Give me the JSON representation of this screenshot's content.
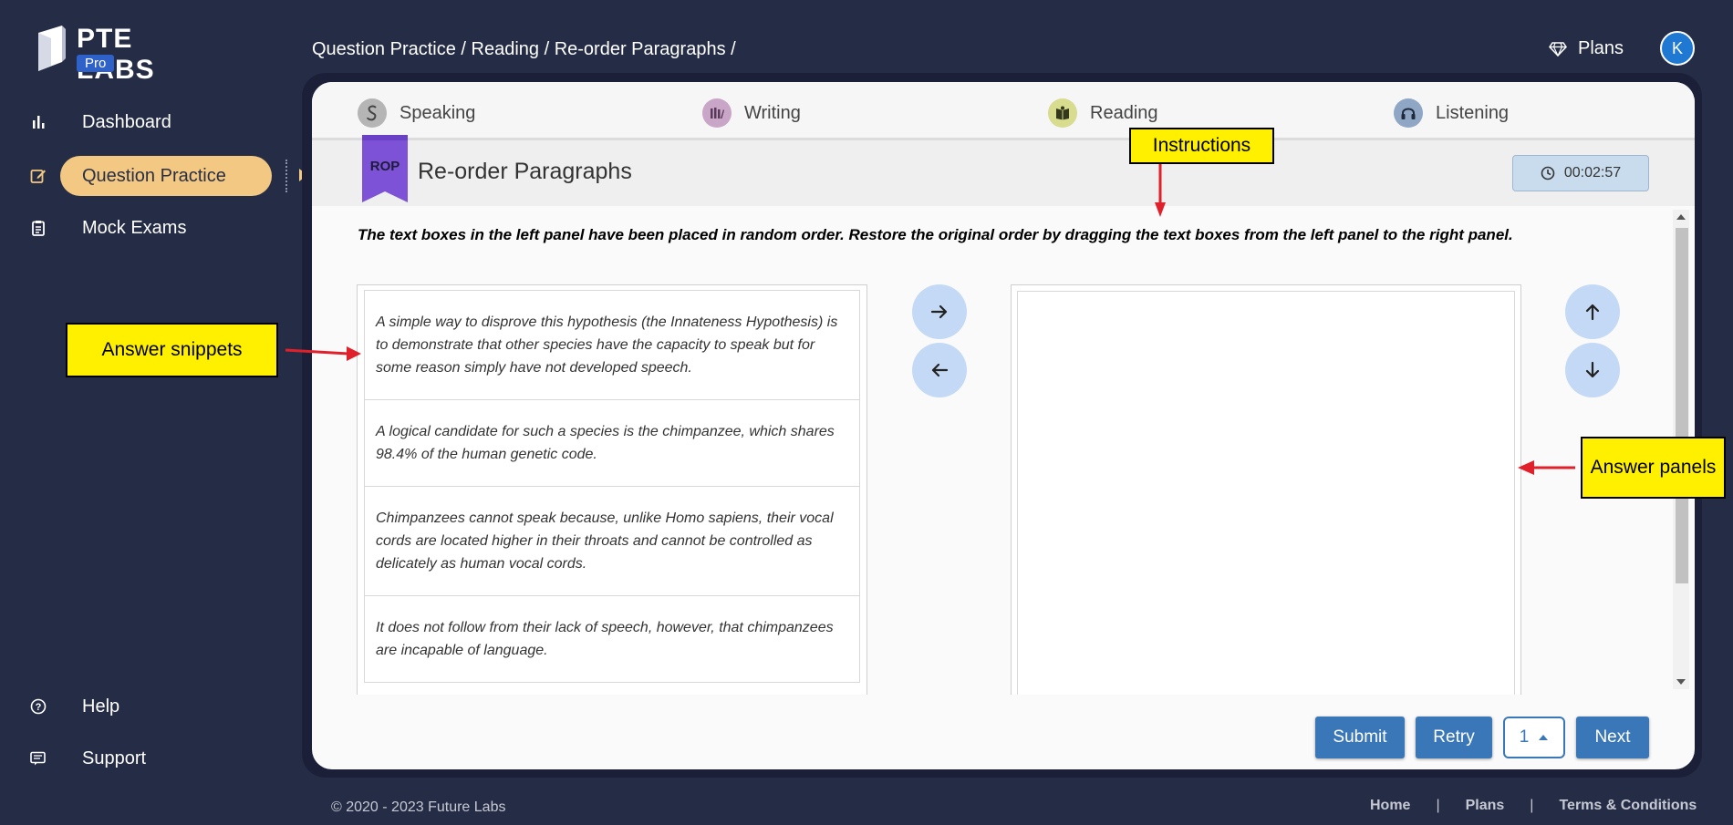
{
  "brand": {
    "name": "PTE LABS",
    "badge": "Pro"
  },
  "sidebar": {
    "items": [
      {
        "label": "Dashboard",
        "icon": "bar-chart-icon"
      },
      {
        "label": "Question Practice",
        "icon": "edit-icon"
      },
      {
        "label": "Mock Exams",
        "icon": "clipboard-icon"
      }
    ],
    "bottom_items": [
      {
        "label": "Help",
        "icon": "help-icon"
      },
      {
        "label": "Support",
        "icon": "support-icon"
      }
    ]
  },
  "header": {
    "breadcrumb": "Question Practice / Reading / Re-order Paragraphs /",
    "plans_label": "Plans",
    "avatar_initial": "K"
  },
  "tabs": [
    {
      "label": "Speaking",
      "color": "#b5b5b5",
      "icon": "S"
    },
    {
      "label": "Writing",
      "color": "#c9a5c8",
      "icon": "W"
    },
    {
      "label": "Reading",
      "color": "#d7dc8f",
      "icon": "R"
    },
    {
      "label": "Listening",
      "color": "#8fa6c5",
      "icon": "L"
    }
  ],
  "question": {
    "badge": "ROP",
    "title": "Re-order Paragraphs",
    "timer": "00:02:57",
    "instructions": "The text boxes in the left panel have been placed in random order. Restore the original order by dragging the text boxes from the left panel to the right panel.",
    "snippets": [
      "A simple way to disprove this hypothesis (the Innateness Hypothesis) is to demonstrate that other species have the capacity to speak but for some reason simply have not developed speech.",
      "A logical candidate for such a species is the chimpanzee, which shares 98.4% of the human genetic code.",
      "Chimpanzees cannot speak because, unlike Homo sapiens, their vocal cords are located higher in their throats and cannot be controlled as delicately as human vocal cords.",
      "It does not follow from their lack of speech, however, that chimpanzees are incapable of language."
    ]
  },
  "actions": {
    "submit": "Submit",
    "retry": "Retry",
    "page": "1",
    "next": "Next"
  },
  "annotations": {
    "instructions": "Instructions",
    "answer_snippets": "Answer snippets",
    "answer_panels": "Answer panels",
    "callout_color": "#fff000",
    "arrow_color": "#e0202b"
  },
  "footer": {
    "copyright": "© 2020 - 2023 Future Labs",
    "links": [
      "Home",
      "Plans",
      "Terms & Conditions"
    ],
    "separator": "|"
  }
}
